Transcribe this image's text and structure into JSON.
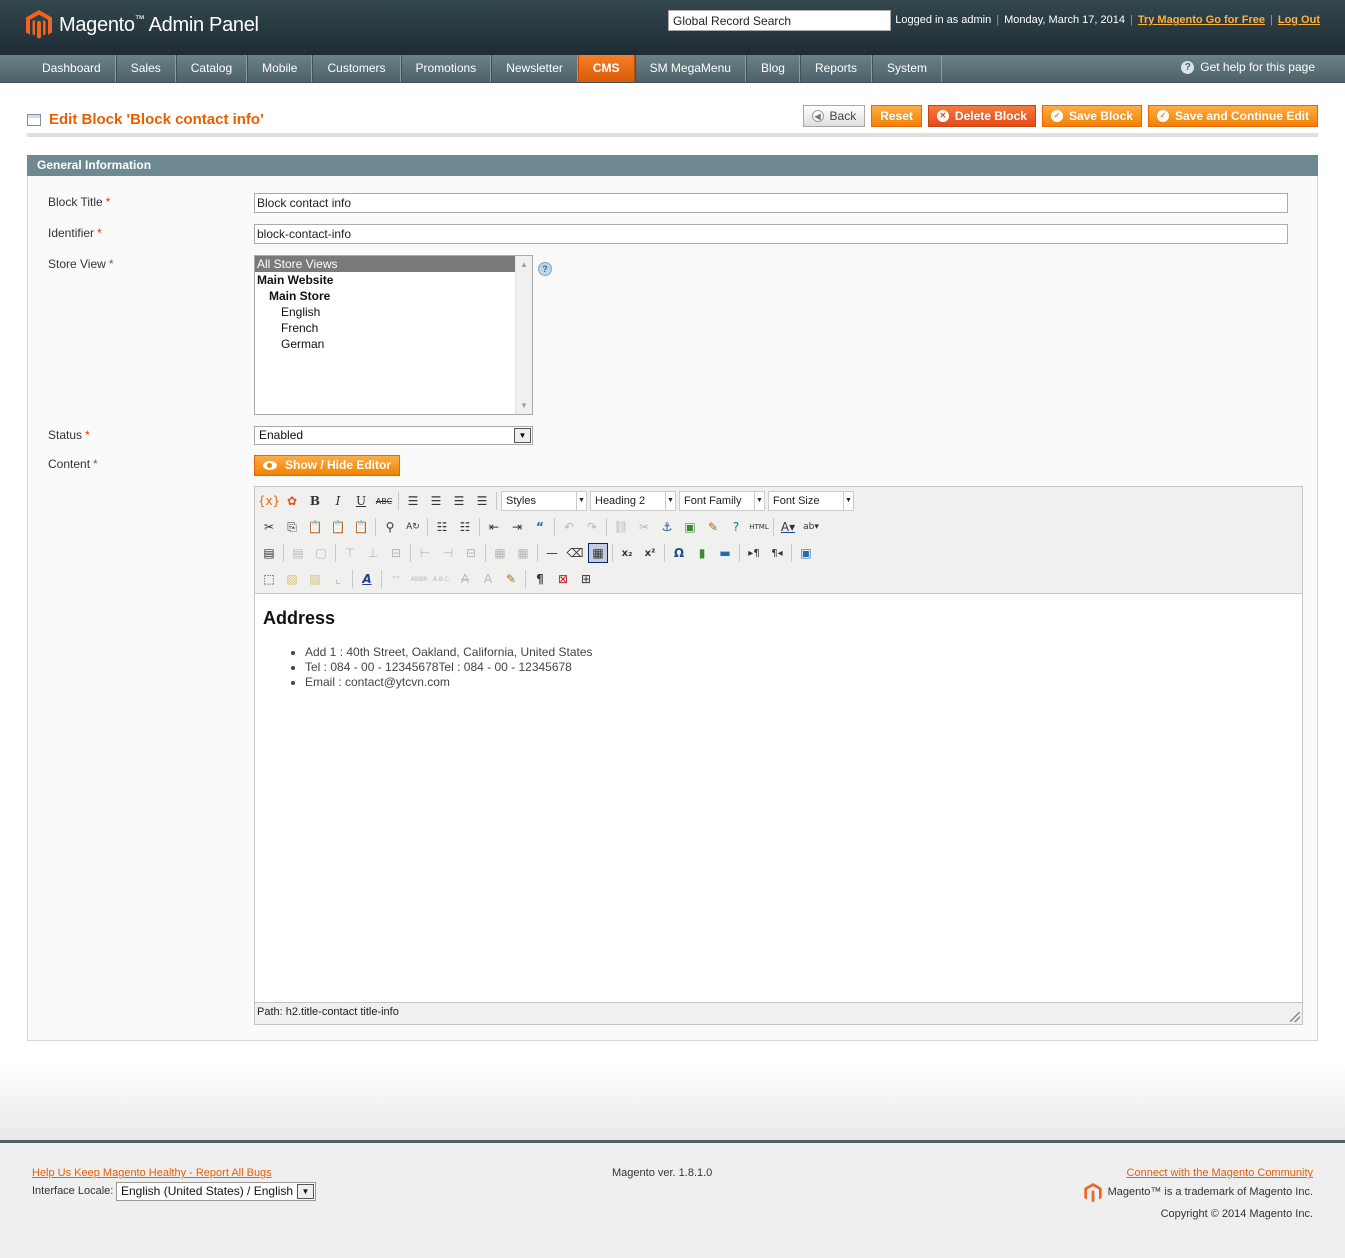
{
  "colors": {
    "header_bg": "#26363d",
    "nav_bg": "#5c7279",
    "accent_orange": "#f18200",
    "title_orange": "#eb5e00",
    "fieldset_head": "#6f8992"
  },
  "header": {
    "logo_text": "Magento",
    "logo_tm": "™",
    "logo_suffix": " Admin Panel",
    "search_value": "Global Record Search",
    "logged_in": "Logged in as admin",
    "date": "Monday, March 17, 2014",
    "try_link": "Try Magento Go for Free",
    "logout_link": "Log Out"
  },
  "nav": {
    "items": [
      {
        "label": "Dashboard"
      },
      {
        "label": "Sales"
      },
      {
        "label": "Catalog"
      },
      {
        "label": "Mobile"
      },
      {
        "label": "Customers"
      },
      {
        "label": "Promotions"
      },
      {
        "label": "Newsletter"
      },
      {
        "label": "CMS",
        "active": true
      },
      {
        "label": "SM MegaMenu"
      },
      {
        "label": "Blog"
      },
      {
        "label": "Reports"
      },
      {
        "label": "System"
      }
    ],
    "help_label": "Get help for this page",
    "help_icon": "help-icon"
  },
  "page": {
    "title": "Edit Block 'Block contact info'",
    "buttons": {
      "back": "Back",
      "reset": "Reset",
      "delete": "Delete Block",
      "save": "Save Block",
      "save_continue": "Save and Continue Edit"
    }
  },
  "form": {
    "section_title": "General Information",
    "block_title_label": "Block Title",
    "block_title_value": "Block contact info",
    "identifier_label": "Identifier",
    "identifier_value": "block-contact-info",
    "store_view_label": "Store View",
    "store_view_options": [
      "All Store Views",
      "Main Website",
      "Main Store",
      "English",
      "French",
      "German"
    ],
    "status_label": "Status",
    "status_value": "Enabled",
    "content_label": "Content",
    "toggle_editor": "Show / Hide Editor",
    "required_mark": "*"
  },
  "editor": {
    "styles_select": "Styles",
    "format_select": "Heading 2",
    "font_family_select": "Font Family",
    "font_size_select": "Font Size",
    "content_heading": "Address",
    "content_items": [
      "Add 1 : 40th Street, Oakland, California, United States",
      "Tel : 084 - 00 - 12345678Tel : 084 - 00 - 12345678",
      "Email : contact@ytcvn.com"
    ],
    "path": "Path: h2.title-contact title-info"
  },
  "footer": {
    "bugs_link": "Help Us Keep Magento Healthy - Report All Bugs",
    "locale_label": "Interface Locale:",
    "locale_value": "English (United States) / English",
    "version": "Magento ver. 1.8.1.0",
    "community_link": "Connect with the Magento Community",
    "trademark": "Magento™ is a trademark of Magento Inc.",
    "copyright": "Copyright © 2014 Magento Inc."
  }
}
